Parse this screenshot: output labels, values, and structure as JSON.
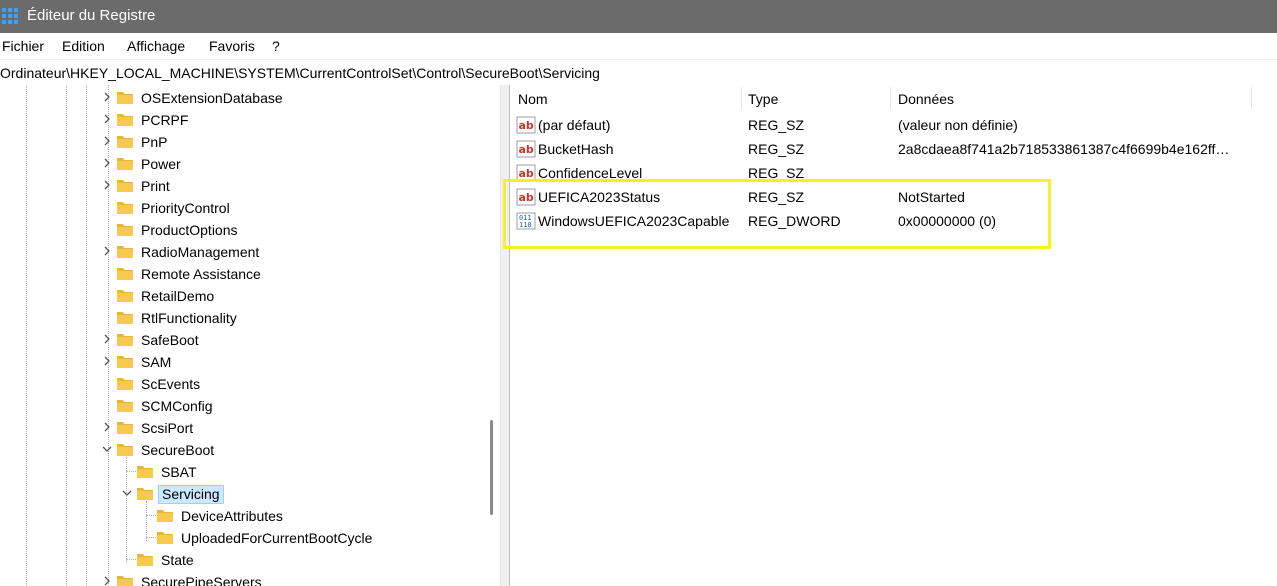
{
  "window": {
    "title": "Éditeur du Registre"
  },
  "menu": [
    "Fichier",
    "Edition",
    "Affichage",
    "Favoris",
    "?"
  ],
  "address": "Ordinateur\\HKEY_LOCAL_MACHINE\\SYSTEM\\CurrentControlSet\\Control\\SecureBoot\\Servicing",
  "tree": {
    "items": [
      {
        "label": "OSExtensionDatabase",
        "expander": "collapsed"
      },
      {
        "label": "PCRPF",
        "expander": "collapsed"
      },
      {
        "label": "PnP",
        "expander": "collapsed"
      },
      {
        "label": "Power",
        "expander": "collapsed"
      },
      {
        "label": "Print",
        "expander": "collapsed"
      },
      {
        "label": "PriorityControl",
        "expander": "none"
      },
      {
        "label": "ProductOptions",
        "expander": "none"
      },
      {
        "label": "RadioManagement",
        "expander": "collapsed"
      },
      {
        "label": "Remote Assistance",
        "expander": "none"
      },
      {
        "label": "RetailDemo",
        "expander": "none"
      },
      {
        "label": "RtlFunctionality",
        "expander": "none"
      },
      {
        "label": "SafeBoot",
        "expander": "collapsed"
      },
      {
        "label": "SAM",
        "expander": "collapsed"
      },
      {
        "label": "ScEvents",
        "expander": "none"
      },
      {
        "label": "SCMConfig",
        "expander": "none"
      },
      {
        "label": "ScsiPort",
        "expander": "collapsed"
      },
      {
        "label": "SecureBoot",
        "expander": "expanded"
      },
      {
        "label": "SBAT",
        "expander": "none"
      },
      {
        "label": "Servicing",
        "expander": "expanded",
        "selected": true
      },
      {
        "label": "DeviceAttributes",
        "expander": "none"
      },
      {
        "label": "UploadedForCurrentBootCycle",
        "expander": "none"
      },
      {
        "label": "State",
        "expander": "none"
      },
      {
        "label": "SecurePipeServers",
        "expander": "collapsed"
      }
    ]
  },
  "list": {
    "headers": {
      "name": "Nom",
      "type": "Type",
      "data": "Données"
    },
    "rows": [
      {
        "icon": "string-value-icon",
        "name": "(par défaut)",
        "type": "REG_SZ",
        "data": "(valeur non définie)"
      },
      {
        "icon": "string-value-icon",
        "name": "BucketHash",
        "type": "REG_SZ",
        "data": "2a8cdaea8f741a2b718533861387c4f6699b4e162ff…"
      },
      {
        "icon": "string-value-icon",
        "name": "ConfidenceLevel",
        "type": "REG_SZ",
        "data": ""
      },
      {
        "icon": "string-value-icon",
        "name": "UEFICA2023Status",
        "type": "REG_SZ",
        "data": "NotStarted"
      },
      {
        "icon": "binary-value-icon",
        "name": "WindowsUEFICA2023Capable",
        "type": "REG_DWORD",
        "data": "0x00000000 (0)"
      }
    ]
  },
  "colors": {
    "titlebar": "#6b6b6b",
    "folder": "#f8c94c",
    "selection": "#cce8ff",
    "highlight": "#f7ef2a"
  }
}
